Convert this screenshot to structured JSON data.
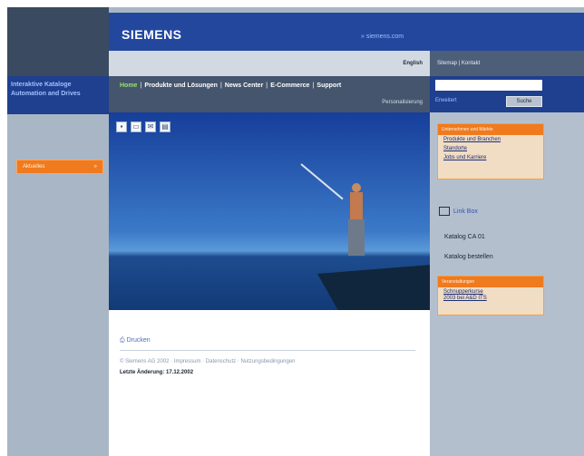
{
  "brand": {
    "logo": "SIEMENS",
    "site_link": "» siemens.com"
  },
  "left": {
    "title_line1": "Interaktive Kataloge",
    "title_line2": "Automation and Drives",
    "orange_label": "Aktuelles",
    "orange_arrow": "»"
  },
  "top": {
    "language": "English",
    "utility": "Sitemap | Kontakt"
  },
  "nav": {
    "items": [
      {
        "label": "Home"
      },
      {
        "label": "Produkte und Lösungen"
      },
      {
        "label": "News Center"
      },
      {
        "label": "E-Commerce"
      },
      {
        "label": "Support"
      }
    ],
    "personalization": "Personalisierung"
  },
  "search": {
    "value": "",
    "placeholder": "",
    "advanced": "Erweitert",
    "button": "Suche"
  },
  "hero_tools": {
    "icons": [
      "save-icon",
      "print-icon",
      "email-icon",
      "folder-icon"
    ]
  },
  "content": {
    "print_link": "Drucken",
    "copyright": "© Siemens AG 2002 · Impressum · Datenschutz · Nutzungsbedingungen",
    "last_change": "Letzte Änderung: 17.12.2002"
  },
  "right": {
    "box1_title": "Unternehmen und Märkte",
    "box1_links": [
      "Produkte und Branchen",
      "Standorte",
      "Jobs und Karriere"
    ],
    "uk_link": "Link Box",
    "catalogs": [
      "Katalog CA 01",
      "Katalog bestellen"
    ],
    "box2_title": "Veranstaltungen",
    "box2_link_line1": "Schnupperkurse",
    "box2_link_line2": "2003 bei A&D ITS"
  }
}
